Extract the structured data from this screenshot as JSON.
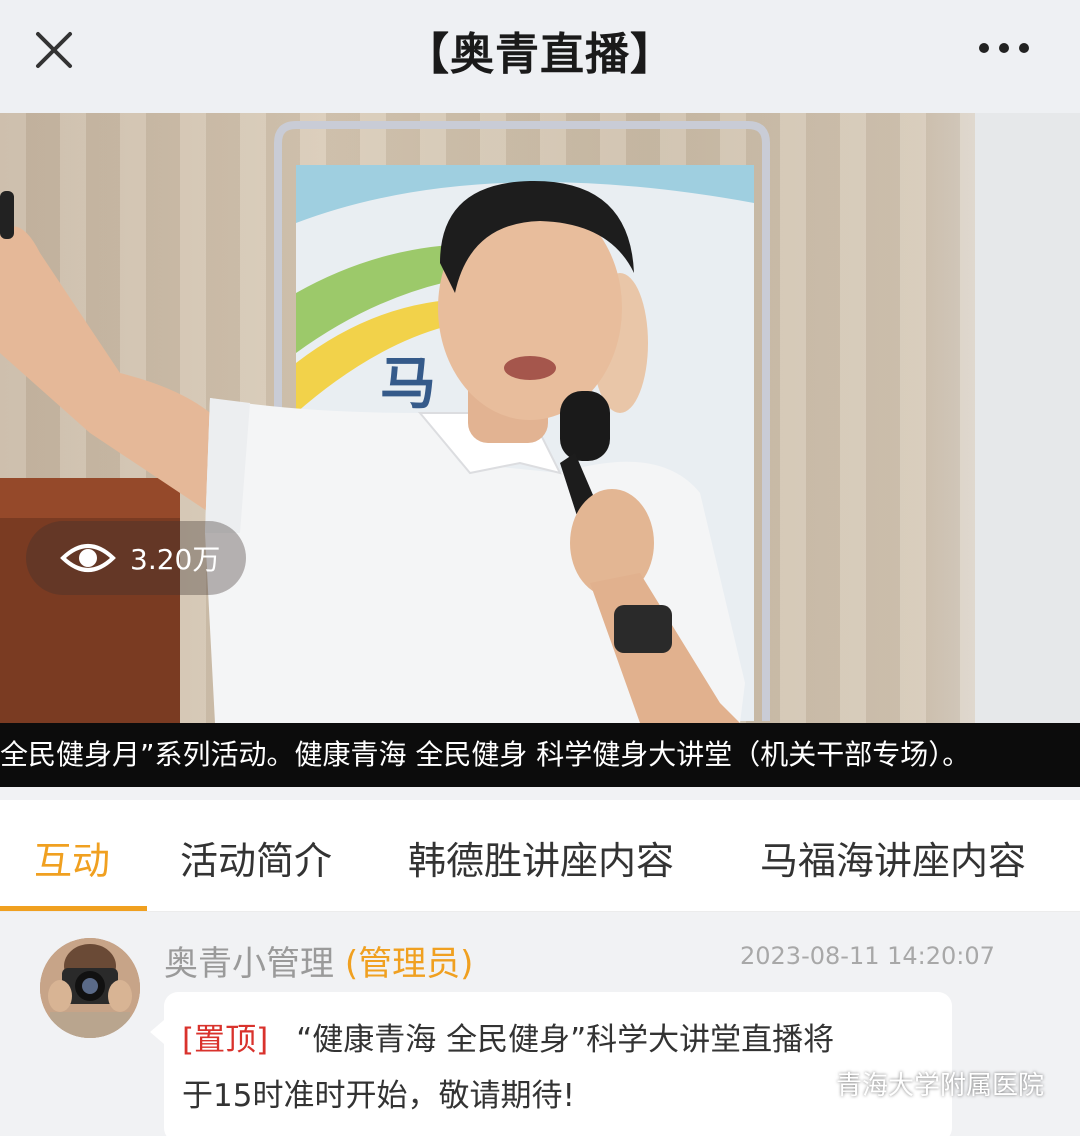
{
  "topbar": {
    "title": "【奥青直播】",
    "close_icon": "close-icon",
    "more_icon": "more-icon"
  },
  "video": {
    "view_count": "3.20万",
    "marquee_text": "全民健身月”系列活动。健康青海 全民健身 科学健身大讲堂（机关干部专场）。",
    "banner_char": "马"
  },
  "tabs": [
    {
      "label": "互动",
      "active": true
    },
    {
      "label": "活动简介",
      "active": false
    },
    {
      "label": "韩德胜讲座内容",
      "active": false
    },
    {
      "label": "马福海讲座内容",
      "active": false
    }
  ],
  "comment": {
    "author": "奥青小管理",
    "role": "(管理员)",
    "timestamp": "2023-08-11 14:20:07",
    "pin_label": "[置顶]",
    "message_line1": "“健康青海 全民健身”科学大讲堂直播将",
    "message_line2": "于15时准时开始，敬请期待!"
  },
  "watermark": "青海大学附属医院",
  "colors": {
    "accent": "#f0a020",
    "pin": "#d9322c",
    "marquee_bg": "#0c0c0c"
  }
}
